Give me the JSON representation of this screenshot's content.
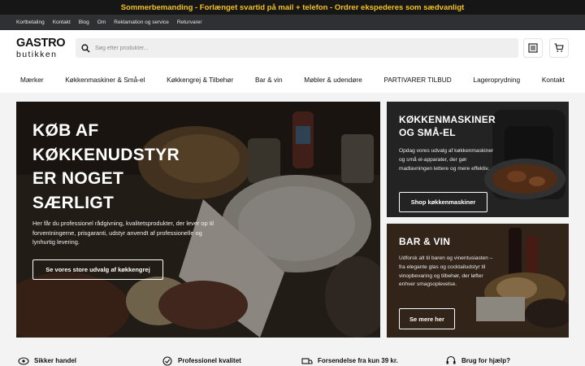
{
  "announcement": "Sommerbemanding - Forlænget svartid på mail + telefon - Ordrer ekspederes som sædvanligt",
  "top_links": [
    "Kortbetaling",
    "Kontakt",
    "Blog",
    "Om",
    "Reklamation og service",
    "Returvarer"
  ],
  "logo": {
    "line1": "GASTRO",
    "line2": "butikken"
  },
  "search": {
    "placeholder": "Søg efter produkter..."
  },
  "header_icons": [
    "list-icon",
    "cart-icon"
  ],
  "nav": [
    "Mærker",
    "Køkkenmaskiner & Små-el",
    "Køkkengrej & Tilbehør",
    "Bar & vin",
    "Møbler & udendøre",
    "PARTIVARER TILBUD",
    "Lageroprydning",
    "Kontakt"
  ],
  "hero": {
    "title_lines": [
      "KØB AF",
      "KØKKENUDSTYR",
      "ER NOGET",
      "SÆRLIGT"
    ],
    "text": "Her får du professionel rådgivning, kvalitetsprodukter, der lever op til forventningerne, prisgaranti, udstyr anvendt af professionelle og lynhurtig levering.",
    "button": "Se vores store udvalg af køkkengrej"
  },
  "card_kitchen": {
    "title_lines": [
      "KØKKENMASKINER",
      "OG SMÅ-EL"
    ],
    "text": "Opdag vores udvalg af køkkenmaskiner og små el-apparater, der gør madlavningen lettere og mere effektiv.",
    "button": "Shop køkkenmaskiner"
  },
  "card_bar": {
    "title": "BAR & VIN",
    "text": "Udforsk alt til baren og vinentusiasten – fra elegante glas og cocktailudstyr til vinopbevaring og tilbehør, der løfter enhver smagsoplevelse.",
    "button": "Se mere her"
  },
  "usps": [
    {
      "icon": "eye-shield-icon",
      "label": "Sikker handel"
    },
    {
      "icon": "check-badge-icon",
      "label": "Professionel kvalitet"
    },
    {
      "icon": "truck-icon",
      "label": "Forsendelse fra kun 39 kr."
    },
    {
      "icon": "support-icon",
      "label": "Brug for hjælp?"
    }
  ],
  "colors": {
    "announcement_bg": "#161616",
    "announcement_text": "#f4c21b",
    "toplinks_bg": "#2f3033"
  }
}
